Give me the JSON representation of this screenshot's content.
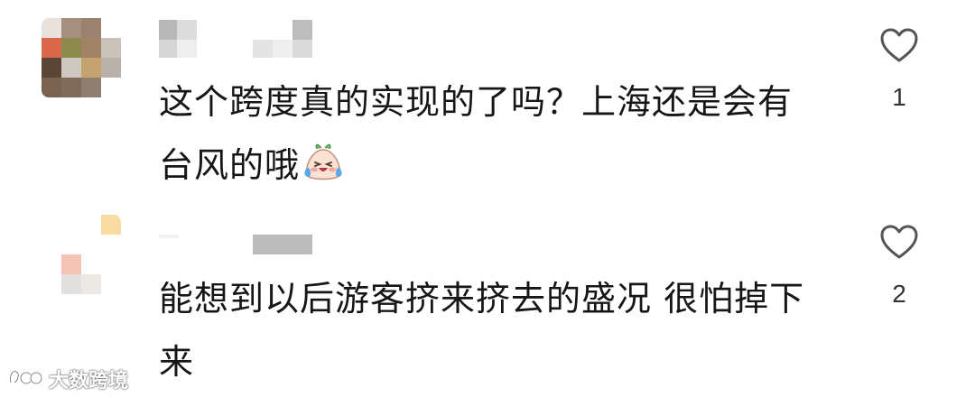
{
  "comments": [
    {
      "text": "这个跨度真的实现的了吗？上海还是会有台风的哦",
      "emoji": "laughing-crying-dumpling-emoji",
      "like_count": "1"
    },
    {
      "text": "能想到以后游客挤来挤去的盛况 很怕掉下来",
      "like_count": "2"
    }
  ],
  "watermark": {
    "text": "大数跨境",
    "icon": "infinity-logo-icon"
  },
  "icons": {
    "like": "heart-outline-icon"
  },
  "colors": {
    "text": "#161616",
    "like_stroke": "#555555",
    "background": "#ffffff"
  }
}
